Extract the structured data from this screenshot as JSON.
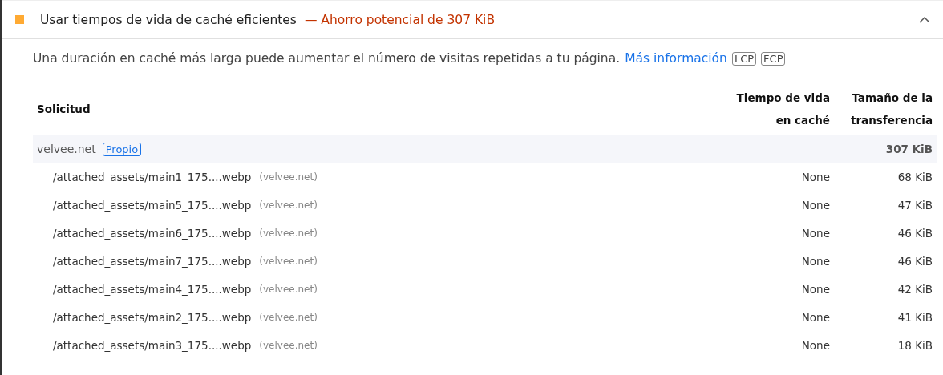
{
  "audit": {
    "color": "#ffaa33",
    "title": "Usar tiempos de vida de caché eficientes",
    "savings": "— Ahorro potencial de 307 KiB",
    "expanded": true
  },
  "description": {
    "text": "Una duración en caché más larga puede aumentar el número de visitas repetidas a tu página.",
    "link": "Más información",
    "metrics": [
      "LCP",
      "FCP"
    ]
  },
  "table": {
    "columns": [
      "Solicitud",
      "Tiempo de vida en caché",
      "Tamaño de la transferencia"
    ],
    "groups": [
      {
        "entity": "velvee.net",
        "badge": "Propio",
        "size": "307 KiB",
        "children": [
          {
            "url": "/attached_assets/main1_175....webp",
            "host": "(velvee.net)",
            "ttl": "None",
            "size": "68 KiB"
          },
          {
            "url": "/attached_assets/main5_175....webp",
            "host": "(velvee.net)",
            "ttl": "None",
            "size": "47 KiB"
          },
          {
            "url": "/attached_assets/main6_175....webp",
            "host": "(velvee.net)",
            "ttl": "None",
            "size": "46 KiB"
          },
          {
            "url": "/attached_assets/main7_175....webp",
            "host": "(velvee.net)",
            "ttl": "None",
            "size": "46 KiB"
          },
          {
            "url": "/attached_assets/main4_175....webp",
            "host": "(velvee.net)",
            "ttl": "None",
            "size": "42 KiB"
          },
          {
            "url": "/attached_assets/main2_175....webp",
            "host": "(velvee.net)",
            "ttl": "None",
            "size": "41 KiB"
          },
          {
            "url": "/attached_assets/main3_175....webp",
            "host": "(velvee.net)",
            "ttl": "None",
            "size": "18 KiB"
          }
        ]
      }
    ]
  }
}
